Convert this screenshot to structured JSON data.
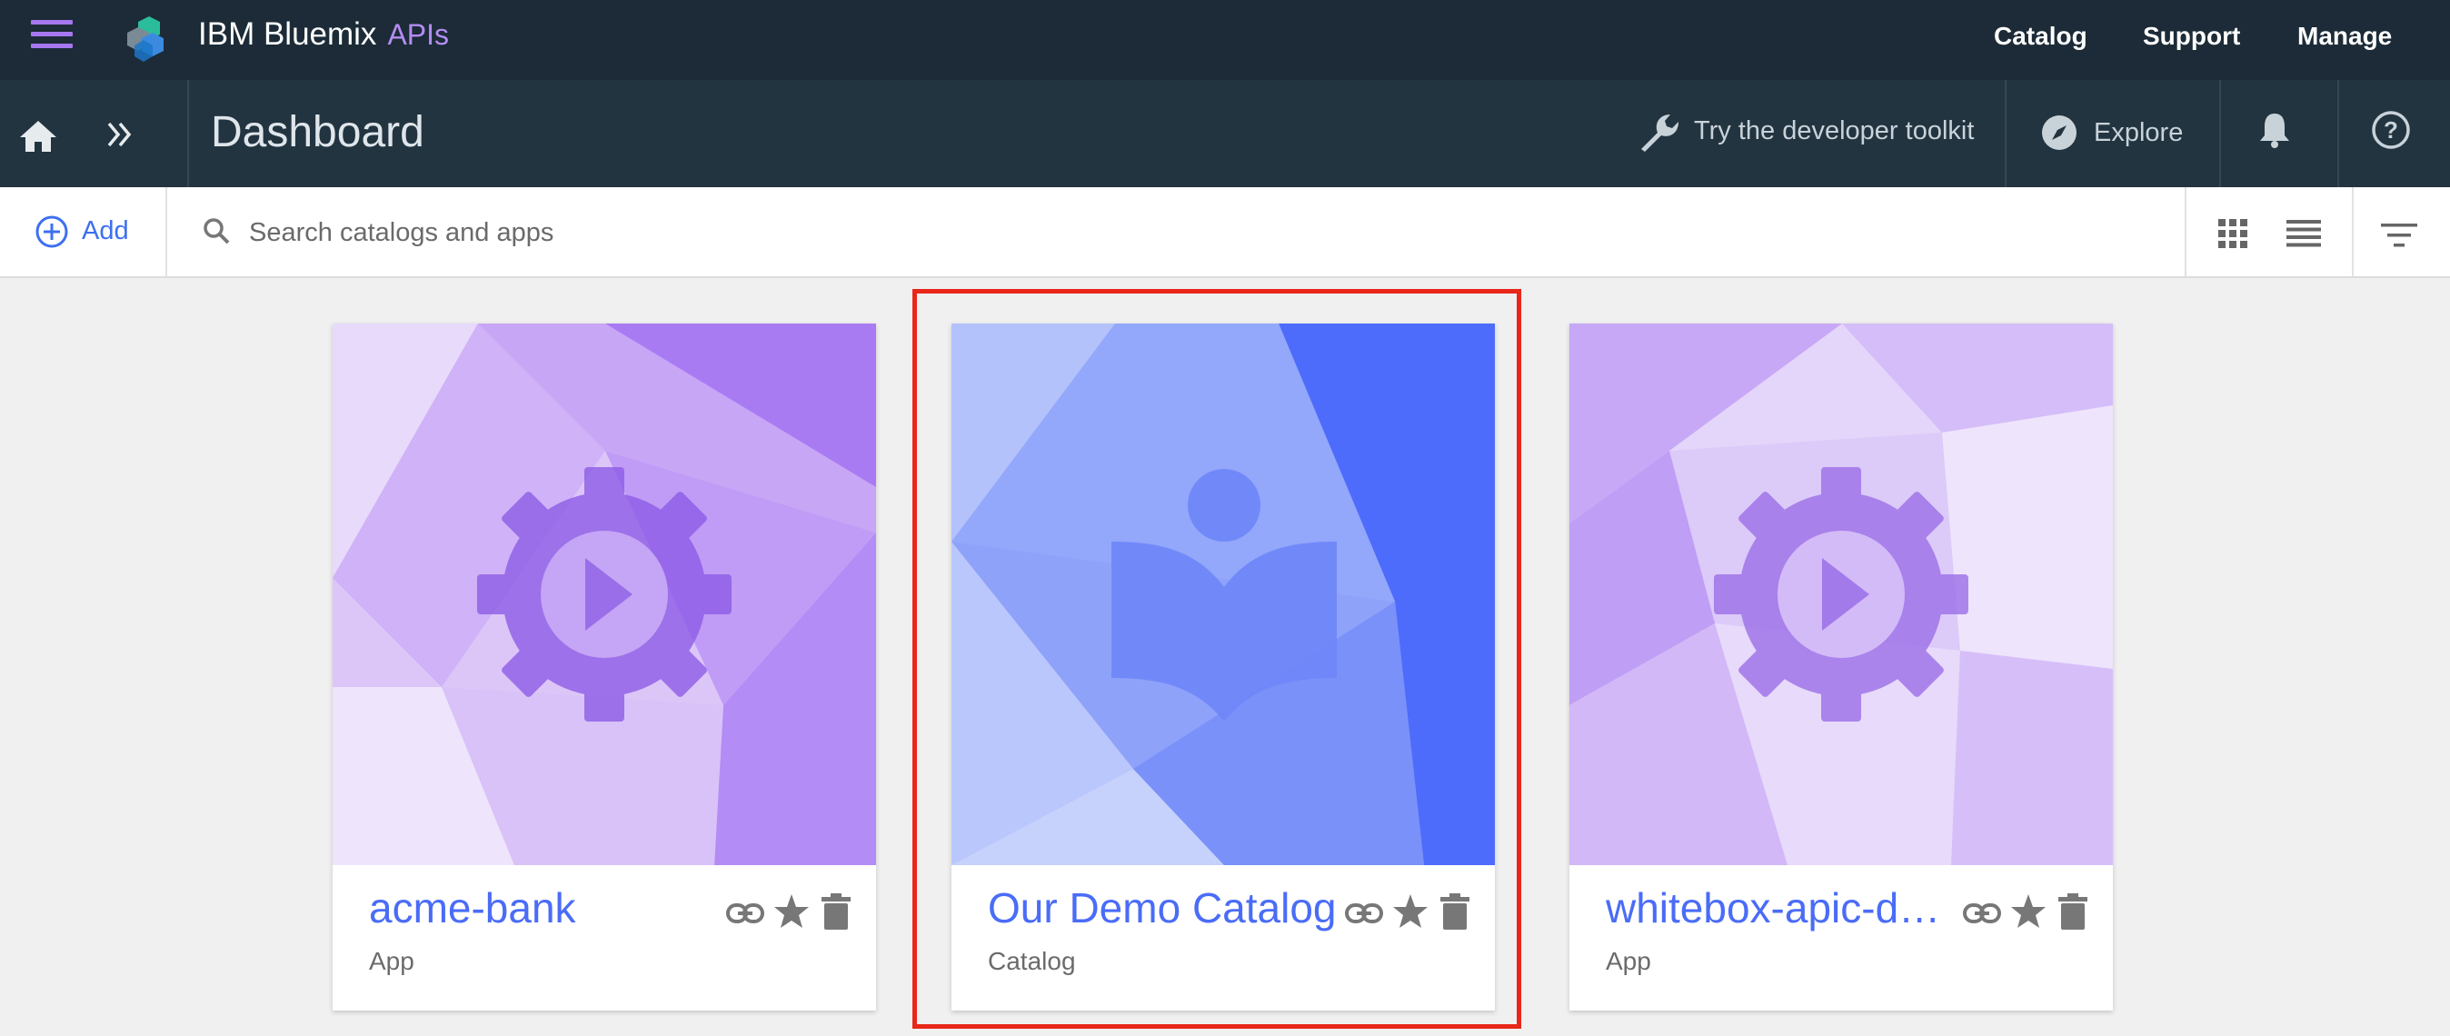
{
  "header": {
    "brand": "IBM Bluemix",
    "brand_suffix": "APIs",
    "nav": [
      "Catalog",
      "Support",
      "Manage"
    ]
  },
  "subheader": {
    "title": "Dashboard",
    "toolkit_label": "Try the developer toolkit",
    "explore_label": "Explore"
  },
  "toolbar": {
    "add_label": "Add",
    "search_placeholder": "Search catalogs and apps"
  },
  "cards": [
    {
      "name": "acme-bank",
      "type": "App",
      "icon": "gear-play-icon",
      "highlighted": false
    },
    {
      "name": "Our Demo Catalog",
      "type": "Catalog",
      "icon": "catalog-reader-icon",
      "highlighted": true
    },
    {
      "name": "whitebox-apic-demo",
      "type": "App",
      "icon": "gear-play-icon",
      "highlighted": false
    }
  ],
  "colors": {
    "topbar": "#1c2b37",
    "subbar": "#223440",
    "accent_purple": "#a678f0",
    "link_blue": "#3d70f0",
    "card_title": "#4a6cf7",
    "highlight": "#e8271a"
  }
}
